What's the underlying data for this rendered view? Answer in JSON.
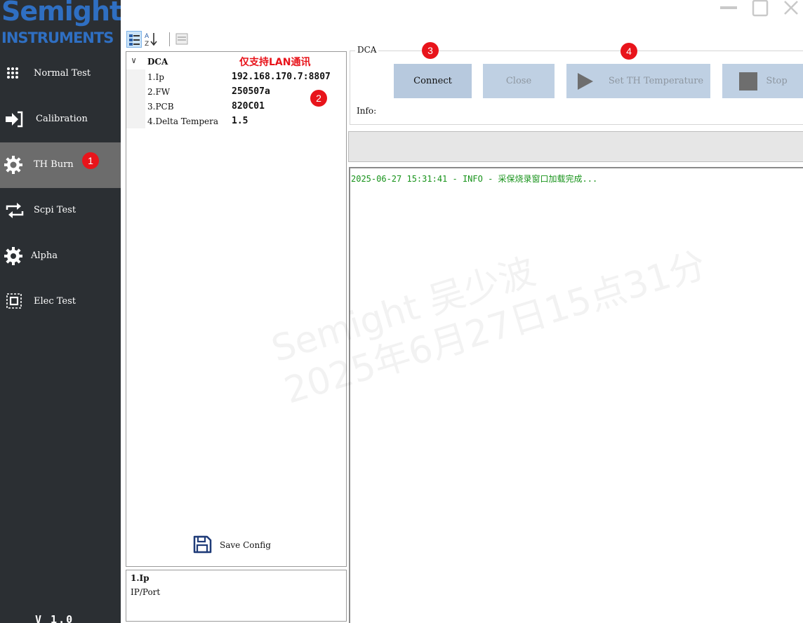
{
  "logo": {
    "line1": "Semight",
    "line2": "INSTRUMENTS"
  },
  "sidebar": {
    "items": [
      {
        "label": "Normal Test",
        "icon": "grid-dots-icon"
      },
      {
        "label": "Calibration",
        "icon": "sign-in-arrow-icon"
      },
      {
        "label": "TH Burn",
        "icon": "gear-icon",
        "active": true
      },
      {
        "label": "Scpi Test",
        "icon": "repeat-arrows-icon"
      },
      {
        "label": "Alpha",
        "icon": "gear-icon"
      },
      {
        "label": "Elec Test",
        "icon": "chip-icon"
      }
    ],
    "version": "V 1.0"
  },
  "badges": {
    "b1": "1",
    "b2": "2",
    "b3": "3",
    "b4": "4"
  },
  "property_grid": {
    "category": "DCA",
    "note": "仅支持LAN通讯",
    "rows": [
      {
        "name": "1.Ip",
        "value": "192.168.170.7:8807"
      },
      {
        "name": "2.FW",
        "value": "250507a"
      },
      {
        "name": "3.PCB",
        "value": "820C01"
      },
      {
        "name": "4.Delta Tempera",
        "value": "1.5"
      }
    ],
    "save_label": "Save Config",
    "desc_title": "1.Ip",
    "desc_text": "IP/Port"
  },
  "dca": {
    "legend": "DCA",
    "connect_label": "Connect",
    "close_label": "Close",
    "set_temp_label": "Set TH Temperature",
    "stop_label": "Stop",
    "info_label": "Info:"
  },
  "log": {
    "lines": [
      "2025-06-27 15:31:41 - INFO - 采保烧录窗口加载完成..."
    ]
  },
  "watermark": {
    "line1": "Semight 吴少波",
    "line2": "2025年6月27日15点31分"
  },
  "colors": {
    "sidebar_bg": "#2b2f33",
    "active_bg": "#6c6c6c",
    "badge": "#e8141b",
    "button": "#b7c9de",
    "log_text": "#17931a",
    "logo": "#2f6fc2"
  }
}
